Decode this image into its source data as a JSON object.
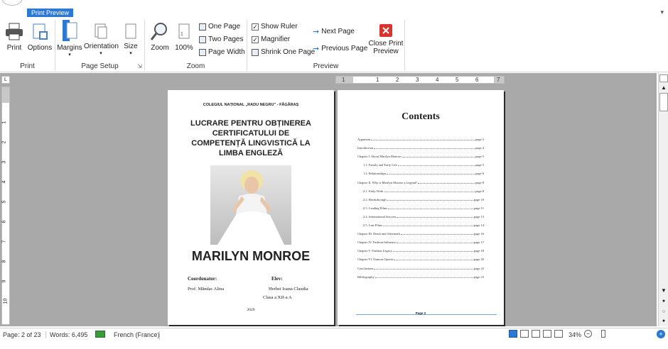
{
  "ribbon": {
    "active_tab": "Print Preview",
    "groups": {
      "print": {
        "label": "Print",
        "print_btn": "Print",
        "options_btn": "Options"
      },
      "page_setup": {
        "label": "Page Setup",
        "margins": "Margins",
        "orientation": "Orientation",
        "size": "Size"
      },
      "zoom": {
        "label": "Zoom",
        "zoom_btn": "Zoom",
        "pct_btn": "100%",
        "one_page": "One Page",
        "two_pages": "Two Pages",
        "page_width": "Page Width"
      },
      "preview": {
        "label": "Preview",
        "show_ruler": "Show Ruler",
        "magnifier": "Magnifier",
        "shrink": "Shrink One Page",
        "next_page": "Next Page",
        "prev_page": "Previous Page",
        "close_line1": "Close Print",
        "close_line2": "Preview"
      }
    }
  },
  "ruler": {
    "numbers": [
      "1",
      "1",
      "2",
      "3",
      "4",
      "5",
      "6",
      "7"
    ],
    "left_numbers": [
      "1",
      "2",
      "3",
      "4",
      "5",
      "6",
      "7",
      "8",
      "9",
      "10"
    ]
  },
  "cover": {
    "school": "COLEGIUL NAȚIONAL „RADU NEGRU” - FĂGĂRAȘ",
    "title": "LUCRARE PENTRU OBȚINEREA CERTIFICATULUI DE COMPETENȚĂ LINGVISTICĂ LA LIMBA ENGLEZĂ",
    "name": "MARILYN MONROE",
    "coord_label": "Coordonator:",
    "coord_name": "Prof. Măndac Alina",
    "student_label": "Elev:",
    "student_name": "Herbei Ioana Claudia",
    "student_class": "Clasa a XII-a  A",
    "year": "2020"
  },
  "toc": {
    "heading": "Contents",
    "footer": "Page 2",
    "items": [
      {
        "title": "Argument",
        "page": "page 3",
        "indent": 0
      },
      {
        "title": "Introduction",
        "page": "page 4",
        "indent": 0
      },
      {
        "title": "Chapter I. About Marilyn Monroe",
        "page": "page 5",
        "indent": 0
      },
      {
        "title": "1.1. Family and Early Life",
        "page": "page 5",
        "indent": 1
      },
      {
        "title": "1.2. Relationships",
        "page": "page 6",
        "indent": 1
      },
      {
        "title": "Chapter II. Why is Marilyn Monroe a Legend?",
        "page": "page 8",
        "indent": 0
      },
      {
        "title": "2.1. Early Work",
        "page": "page 8",
        "indent": 1
      },
      {
        "title": "2.2. Breakthrough",
        "page": "page 10",
        "indent": 1
      },
      {
        "title": "2.3. Leading Films",
        "page": "page 11",
        "indent": 1
      },
      {
        "title": "2.4. International Success",
        "page": "page 13",
        "indent": 1
      },
      {
        "title": "2.5. Last Films",
        "page": "page 14",
        "indent": 1
      },
      {
        "title": "Chapter III. Death and Aftermath",
        "page": "page 16",
        "indent": 0
      },
      {
        "title": "Chapter IV. Fashion Influence",
        "page": "page 17",
        "indent": 0
      },
      {
        "title": "Chapter V. Fashion Legacy",
        "page": "page 18",
        "indent": 0
      },
      {
        "title": "Chapter VI. Famous Quotes",
        "page": "page 20",
        "indent": 0
      },
      {
        "title": "Conclusions",
        "page": "page 22",
        "indent": 0
      },
      {
        "title": "Bibliography",
        "page": "page 23",
        "indent": 0
      }
    ]
  },
  "status": {
    "page": "Page: 2 of 23",
    "words": "Words: 6,495",
    "language": "French (France)",
    "zoom": "34%"
  },
  "colors": {
    "accent": "#2b79d3",
    "workspace": "#a9a9a9",
    "close_red": "#d9322f"
  }
}
